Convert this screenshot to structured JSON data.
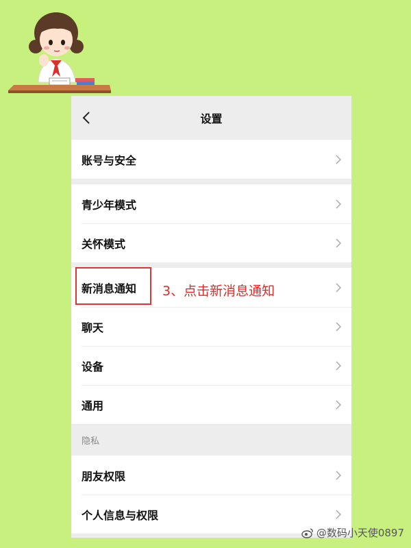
{
  "header": {
    "title": "设置"
  },
  "groups": [
    {
      "items": [
        {
          "label": "账号与安全"
        }
      ]
    },
    {
      "items": [
        {
          "label": "青少年模式"
        },
        {
          "label": "关怀模式"
        }
      ]
    },
    {
      "items": [
        {
          "label": "新消息通知"
        },
        {
          "label": "聊天"
        },
        {
          "label": "设备"
        },
        {
          "label": "通用"
        }
      ]
    },
    {
      "section_label": "隐私",
      "items": [
        {
          "label": "朋友权限"
        },
        {
          "label": "个人信息与权限"
        }
      ]
    }
  ],
  "annotation": {
    "text": "3、点击新消息通知",
    "color": "#e02a25"
  },
  "watermark": {
    "text": "@数码小天使0897"
  },
  "colors": {
    "background": "#c8f07f",
    "panel_bg": "#ededed",
    "highlight": "#e0342f"
  },
  "icons": {
    "back": "chevron-left-icon",
    "row": "chevron-right-icon",
    "watermark": "weibo-logo-icon"
  }
}
